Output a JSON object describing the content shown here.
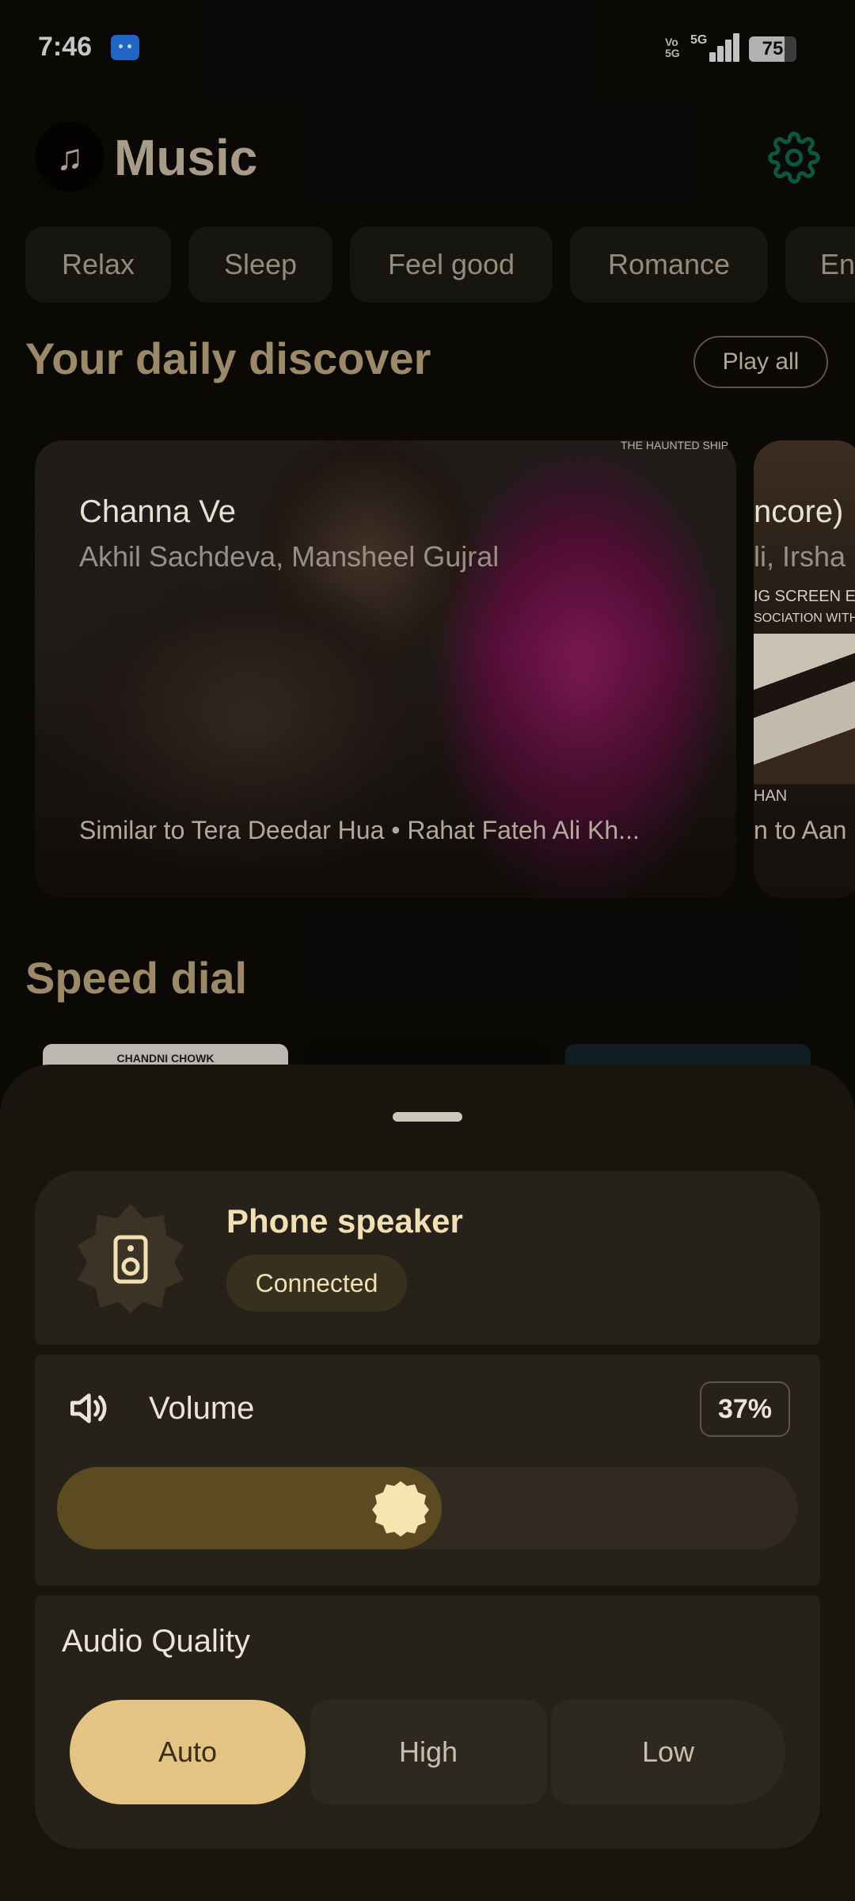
{
  "status_bar": {
    "time": "7:46",
    "volte": "Vo\n5G",
    "network": "5G",
    "battery": "75",
    "battery_level": 0.75
  },
  "header": {
    "title": "Music",
    "logo_icon": "music-note-icon",
    "settings_icon": "gear-icon"
  },
  "chips": [
    "Relax",
    "Sleep",
    "Feel good",
    "Romance",
    "En"
  ],
  "discover": {
    "title": "Your daily discover",
    "play_all": "Play all",
    "cards": [
      {
        "title": "Channa Ve",
        "artist": "Akhil Sachdeva, Mansheel Gujral",
        "subtitle": "Similar to Tera Deedar Hua • Rahat Fateh Ali Kh...",
        "watermark": "THE HAUNTED SHIP"
      },
      {
        "title": "ncore)",
        "artist": "li, Irsha",
        "poster_line1": "IG SCREEN EN",
        "poster_line2": "SOCIATION WITH Z",
        "poster_line3": "HAN",
        "subtitle": "n to Aan"
      }
    ]
  },
  "speed_dial": {
    "title": "Speed dial",
    "tile_label": "CHANDNI CHOWK"
  },
  "sheet": {
    "device": {
      "name": "Phone speaker",
      "status": "Connected",
      "icon": "speaker-icon"
    },
    "volume": {
      "label": "Volume",
      "percent_text": "37%",
      "level": 0.37,
      "icon": "volume-icon"
    },
    "quality": {
      "label": "Audio Quality",
      "options": [
        "Auto",
        "High",
        "Low"
      ],
      "selected": "Auto"
    },
    "colors": {
      "accent": "#e4c484",
      "sheet_bg": "#18150f",
      "card_bg": "#26221a"
    }
  }
}
